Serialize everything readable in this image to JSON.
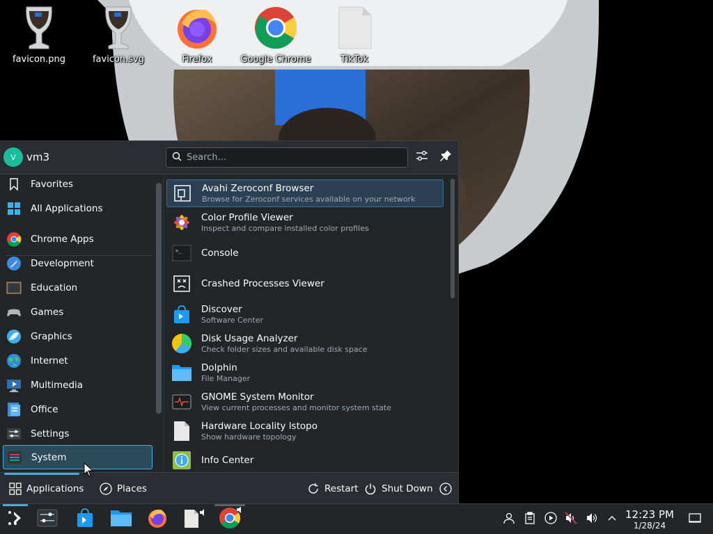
{
  "desktop": {
    "icons": [
      {
        "label": "favicon.png",
        "icon": "wine-glass-icon"
      },
      {
        "label": "favicon.svg",
        "icon": "wine-glass-icon"
      },
      {
        "label": "Firefox",
        "icon": "firefox-icon"
      },
      {
        "label": "Google Chrome",
        "icon": "chrome-icon"
      },
      {
        "label": "TikTok",
        "icon": "file-icon"
      }
    ]
  },
  "launcher": {
    "user": {
      "initial": "V",
      "name": "vm3"
    },
    "search": {
      "placeholder": "Search..."
    },
    "categories": [
      {
        "label": "Favorites",
        "icon": "bookmark-icon"
      },
      {
        "label": "All Applications",
        "icon": "grid-icon"
      },
      {
        "label": "Chrome Apps",
        "icon": "chrome-icon"
      },
      {
        "label": "Development",
        "icon": "development-icon"
      },
      {
        "label": "Education",
        "icon": "education-icon"
      },
      {
        "label": "Games",
        "icon": "gamepad-icon"
      },
      {
        "label": "Graphics",
        "icon": "graphics-icon"
      },
      {
        "label": "Internet",
        "icon": "globe-icon"
      },
      {
        "label": "Multimedia",
        "icon": "multimedia-icon"
      },
      {
        "label": "Office",
        "icon": "office-icon"
      },
      {
        "label": "Settings",
        "icon": "settings-icon"
      },
      {
        "label": "System",
        "icon": "system-icon",
        "selected": true
      }
    ],
    "apps": [
      {
        "name": "Avahi Zeroconf Browser",
        "desc": "Browse for Zeroconf services available on your network",
        "icon": "network-icon",
        "highlighted": true
      },
      {
        "name": "Color Profile Viewer",
        "desc": "Inspect and compare installed color profiles",
        "icon": "color-flower-icon"
      },
      {
        "name": "Console",
        "desc": "",
        "icon": "terminal-icon"
      },
      {
        "name": "Crashed Processes Viewer",
        "desc": "",
        "icon": "crash-icon"
      },
      {
        "name": "Discover",
        "desc": "Software Center",
        "icon": "discover-bag-icon"
      },
      {
        "name": "Disk Usage Analyzer",
        "desc": "Check folder sizes and available disk space",
        "icon": "pie-disk-icon"
      },
      {
        "name": "Dolphin",
        "desc": "File Manager",
        "icon": "folder-icon"
      },
      {
        "name": "GNOME System Monitor",
        "desc": "View current processes and monitor system state",
        "icon": "system-monitor-icon"
      },
      {
        "name": "Hardware Locality lstopo",
        "desc": "Show hardware topology",
        "icon": "blank-file-icon"
      },
      {
        "name": "Info Center",
        "desc": "",
        "icon": "info-icon"
      }
    ],
    "footer": {
      "applications": "Applications",
      "places": "Places",
      "restart": "Restart",
      "shutdown": "Shut Down"
    }
  },
  "taskbar": {
    "items": [
      "app-launcher-icon",
      "system-settings-icon",
      "discover-icon",
      "dolphin-icon",
      "firefox-icon",
      "file-audio-icon",
      "chrome-icon"
    ],
    "clock": {
      "time": "12:23 PM",
      "date": "1/28/24"
    }
  },
  "colors": {
    "accent": "#3daee9",
    "panel": "#232629",
    "header": "#2a2e32"
  }
}
